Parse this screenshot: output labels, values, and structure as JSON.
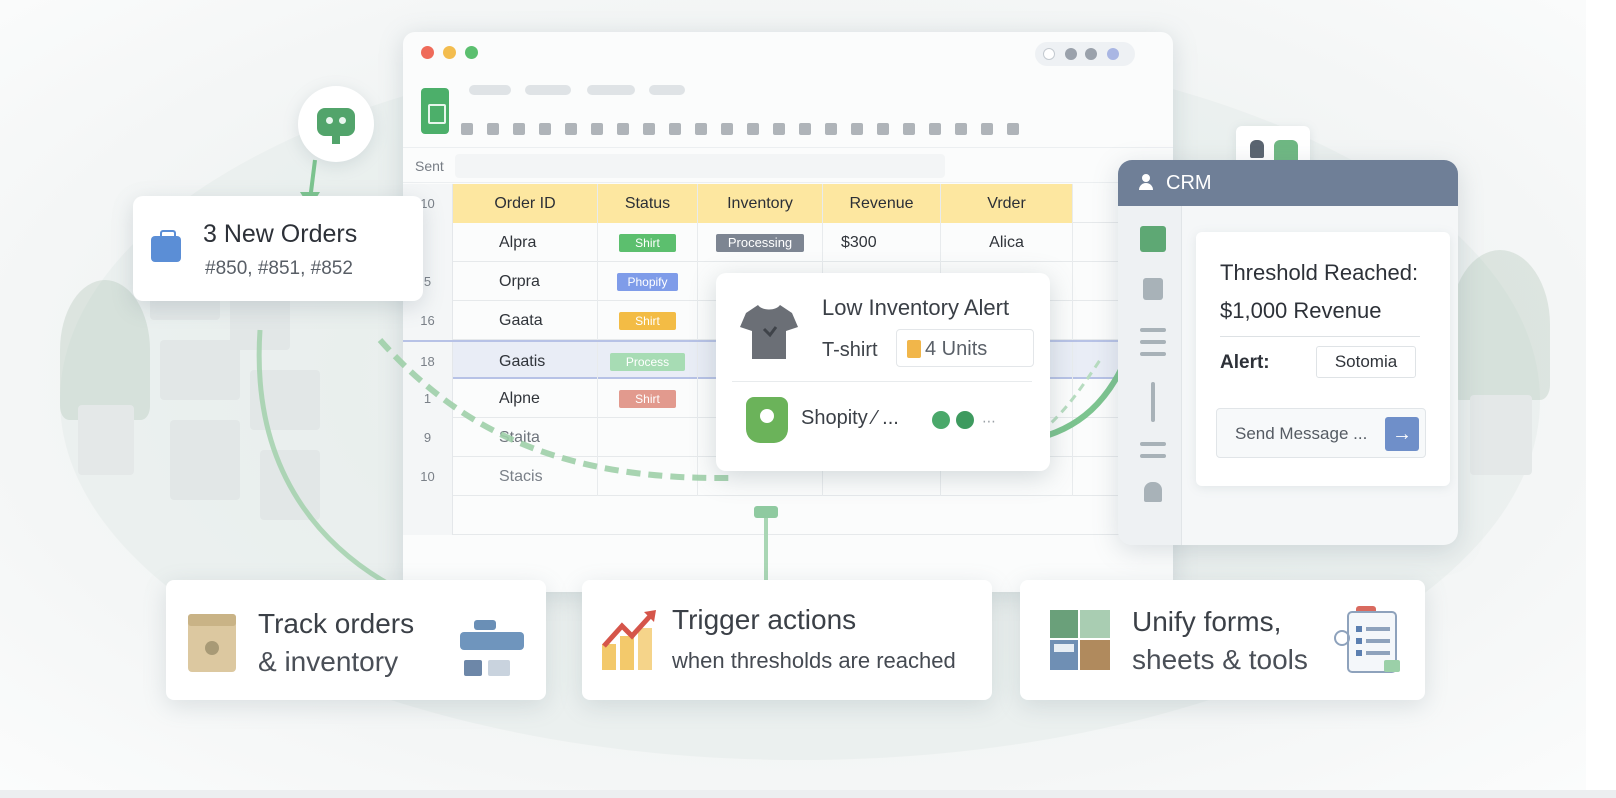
{
  "sheet": {
    "formula_label": "Sent",
    "columns": [
      "Order ID",
      "Status",
      "Inventory",
      "Revenue",
      "Vrder"
    ],
    "header_rownum": "10",
    "rows": [
      {
        "num": "",
        "order": "Alpra",
        "status": "Shirt",
        "status_color": "#5cbf6e",
        "inventory": "Processing",
        "inventory_color": "#7d8592",
        "revenue": "$300",
        "vendor": "Alica"
      },
      {
        "num": "5",
        "order": "Orpra",
        "status": "Phopify",
        "status_color": "#7f9ce9"
      },
      {
        "num": "16",
        "order": "Gaata",
        "status": "Shirt",
        "status_color": "#f3bc45"
      },
      {
        "num": "18",
        "order": "Gaatis",
        "status": "Process",
        "status_color": "#a7dcb4"
      },
      {
        "num": "1",
        "order": "Alpne",
        "status": "Shirt",
        "status_color": "#e29a8e"
      },
      {
        "num": "9",
        "order": "Staita"
      },
      {
        "num": "10",
        "order": "Stacis"
      }
    ]
  },
  "orders_card": {
    "title": "3 New Orders",
    "subtitle": "#850, #851, #852",
    "icon": "briefcase-icon"
  },
  "inventory_alert": {
    "title": "Low Inventory Alert",
    "item": "T-shirt",
    "units": "4 Units",
    "integration": "Shopity ⁄ ...",
    "icon": "tshirt-icon"
  },
  "crm": {
    "title": "CRM",
    "threshold_line1": "Threshold Reached:",
    "threshold_line2": "$1,000 Revenue",
    "alert_label": "Alert:",
    "alert_value": "Sotomia",
    "send_placeholder": "Send Message ...",
    "send_icon": "arrow-right-icon"
  },
  "features": [
    {
      "title": "Track orders",
      "subtitle": "& inventory",
      "icon": "package-icon"
    },
    {
      "title": "Trigger actions",
      "subtitle": "when thresholds are reached",
      "icon": "trend-up-icon"
    },
    {
      "title": "Unify forms,",
      "subtitle": "sheets & tools",
      "icon": "forms-icon"
    }
  ],
  "colors": {
    "accent_green": "#52a46b",
    "header_yellow": "#fde7a0",
    "crm_header": "#6f7f97",
    "send_button": "#6f8fc9"
  }
}
